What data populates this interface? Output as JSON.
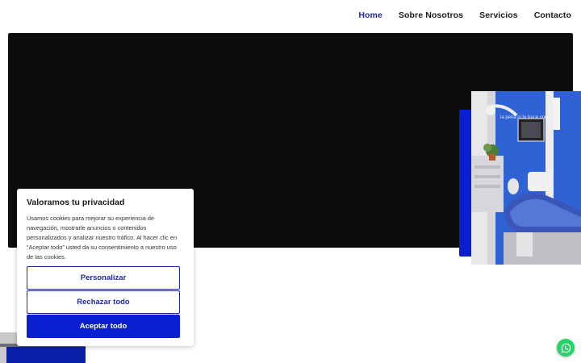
{
  "nav": {
    "items": [
      {
        "label": "Home",
        "active": true
      },
      {
        "label": "Sobre Nosotros",
        "active": false
      },
      {
        "label": "Servicios",
        "active": false
      },
      {
        "label": "Contacto",
        "active": false
      }
    ]
  },
  "photo": {
    "wall_text": "la pena si te hace sonr"
  },
  "cookie": {
    "title": "Valoramos tu privacidad",
    "text": "Usamos cookies para mejorar su experiencia de navegación, mostrarle anuncios o contenidos personalizados y analizar nuestro tráfico. Al hacer clic en “Aceptar todo” usted da su consentimiento a nuestro uso de las cookies.",
    "customize_label": "Personalizar",
    "reject_label": "Rechazar todo",
    "accept_label": "Aceptar todo"
  },
  "colors": {
    "brand_blue": "#0a1fd0",
    "nav_active": "#1d2b9a",
    "hero_bg": "#0d0d0e",
    "whatsapp_green": "#25d366"
  },
  "icons": {
    "whatsapp": "whatsapp-icon"
  }
}
